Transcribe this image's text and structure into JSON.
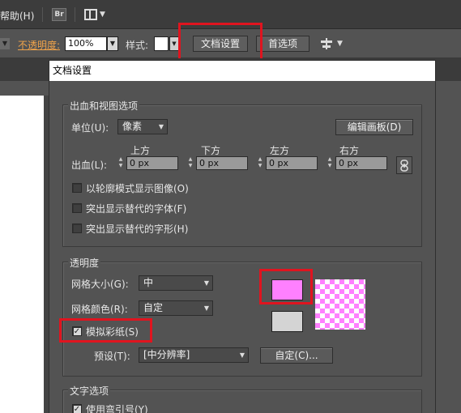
{
  "menubar": {
    "help_label": "帮助(H)",
    "br_label": "Br"
  },
  "control_bar": {
    "opacity_label": "不透明度:",
    "opacity_value": "100%",
    "style_label": "样式:",
    "doc_setup_button": "文档设置",
    "prefs_button": "首选项"
  },
  "dialog": {
    "title": "文档设置",
    "bleed_group": {
      "title": "出血和视图选项",
      "unit_label": "单位(U):",
      "unit_value": "像素",
      "edit_artboards_button": "编辑画板(D)",
      "bleed_label": "出血(L):",
      "fields": [
        {
          "label": "上方",
          "value": "0 px"
        },
        {
          "label": "下方",
          "value": "0 px"
        },
        {
          "label": "左方",
          "value": "0 px"
        },
        {
          "label": "右方",
          "value": "0 px"
        }
      ],
      "options": [
        {
          "label": "以轮廓模式显示图像(O)",
          "checked": false
        },
        {
          "label": "突出显示替代的字体(F)",
          "checked": false
        },
        {
          "label": "突出显示替代的字形(H)",
          "checked": false
        }
      ]
    },
    "transparency_group": {
      "title": "透明度",
      "grid_size_label": "网格大小(G):",
      "grid_size_value": "中",
      "grid_color_label": "网格颜色(R):",
      "grid_color_value": "自定",
      "simulate_paper_label": "模拟彩纸(S)",
      "simulate_paper_checked": true,
      "preset_label": "预设(T):",
      "preset_value": "[中分辨率]",
      "custom_button": "自定(C)...",
      "swatch_color_1": "#ff80ff",
      "swatch_color_2": "#d4d4d4"
    },
    "text_group": {
      "title": "文字选项",
      "use_quotes_label": "使用弯引号(Y)",
      "use_quotes_checked": true
    }
  },
  "colors": {
    "highlight_red": "#e0141f",
    "opacity_orange": "#f0a34a"
  }
}
